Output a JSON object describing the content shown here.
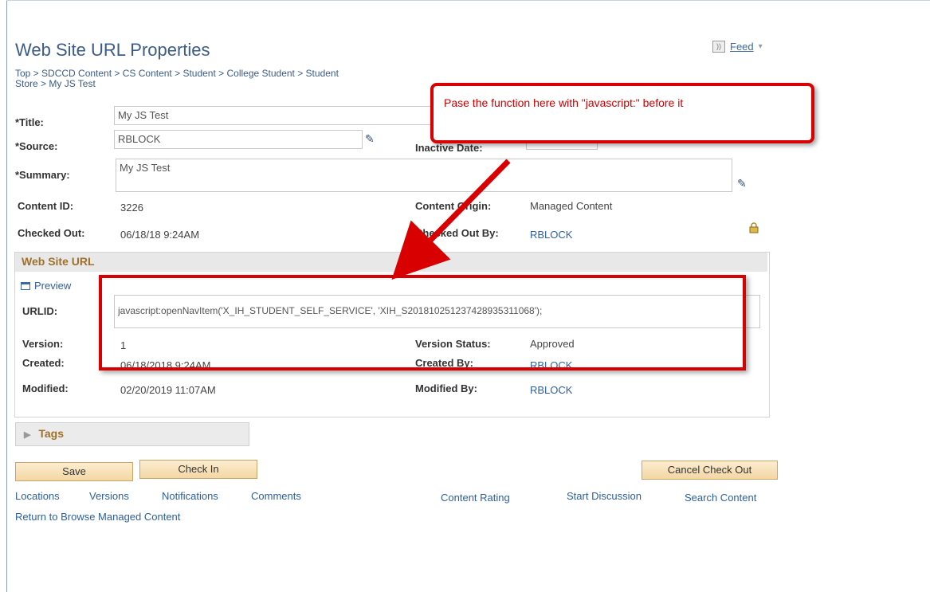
{
  "page": {
    "title": "Web Site URL Properties",
    "breadcrumb": "Top > SDCCD Content > CS Content > Student > College Student > Student Store > My JS Test",
    "feed_label": "Feed",
    "feed_caret": "▾"
  },
  "form": {
    "title_label": "*Title:",
    "title_value": "My JS Test",
    "source_label": "*Source:",
    "source_value": "RBLOCK",
    "inactive_date_label": "Inactive Date:",
    "summary_label": "*Summary:",
    "summary_value": "My JS Test",
    "content_id_label": "Content ID:",
    "content_id_value": "3226",
    "content_origin_label": "Content Origin:",
    "content_origin_value": "Managed Content",
    "checked_out_label": "Checked Out:",
    "checked_out_value": "06/18/18  9:24AM",
    "checked_out_by_label": "Checked Out By:",
    "checked_out_by_value": "RBLOCK"
  },
  "web_site_url": {
    "section_title": "Web Site URL",
    "preview_label": "Preview",
    "urlid_label": "URLID:",
    "urlid_value": "javascript:openNavItem('X_IH_STUDENT_SELF_SERVICE', 'XIH_S201810251237428935311068');",
    "version_label": "Version:",
    "version_value": "1",
    "version_status_label": "Version Status:",
    "version_status_value": "Approved",
    "created_label": "Created:",
    "created_value": "06/18/2018  9:24AM",
    "created_by_label": "Created By:",
    "created_by_value": "RBLOCK",
    "modified_label": "Modified:",
    "modified_value": "02/20/2019 11:07AM",
    "modified_by_label": "Modified By:",
    "modified_by_value": "RBLOCK"
  },
  "tags": {
    "label": "Tags"
  },
  "buttons": {
    "save": "Save",
    "check_in": "Check In",
    "cancel_check_out": "Cancel Check Out"
  },
  "links": {
    "locations": "Locations",
    "versions": "Versions",
    "notifications": "Notifications",
    "comments": "Comments",
    "content_rating": "Content Rating",
    "start_discussion": "Start Discussion",
    "search_content": "Search Content",
    "return_browse": "Return to Browse Managed Content"
  },
  "annotation": {
    "callout_text": "Pase the function here with \"javascript:\" before it",
    "color": "#d80000"
  },
  "colors": {
    "title_blue": "#3b5b8a",
    "section_gold": "#a0702a",
    "link_blue": "#2d5f9e"
  },
  "icons": {
    "feed": "rss-feed-icon",
    "lookup": "magic-wand-icon",
    "lock": "padlock-icon",
    "preview": "preview-window-icon",
    "expand": "triangle-right-icon"
  }
}
